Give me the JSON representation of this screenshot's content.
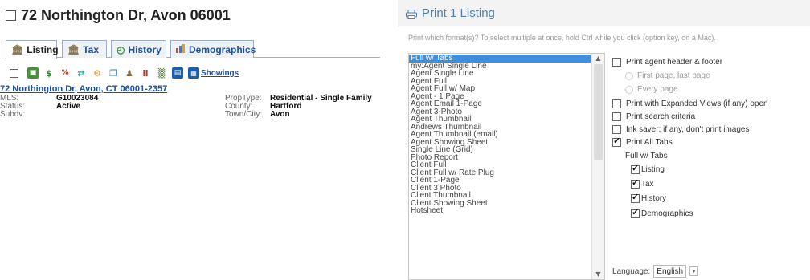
{
  "listing": {
    "title": "72 Northington Dr, Avon 06001",
    "tabs": [
      {
        "label": "Listing",
        "icon": "house-icon"
      },
      {
        "label": "Tax",
        "icon": "house-icon"
      },
      {
        "label": "History",
        "icon": "clock-icon"
      },
      {
        "label": "Demographics",
        "icon": "bar-chart-icon"
      }
    ],
    "showings_label": "Showings",
    "address_link": "72 Northington Dr, Avon, CT 06001-2357",
    "facts_left": [
      {
        "label": "MLS:",
        "value": "G10023084"
      },
      {
        "label": "Status:",
        "value": "Active"
      },
      {
        "label": "Subdv:",
        "value": ""
      }
    ],
    "facts_right": [
      {
        "label": "PropType:",
        "value": "Residential - Single Family"
      },
      {
        "label": "County:",
        "value": "Hartford"
      },
      {
        "label": "Town/City:",
        "value": "Avon"
      }
    ]
  },
  "print_dialog": {
    "title": "Print 1 Listing",
    "instructions": "Print which format(s)? To select multiple at once, hold Ctrl while you click (option key, on a Mac).",
    "formats": [
      "Full w/ Tabs",
      "my:Agent Single Line",
      "Agent Single Line",
      "Agent Full",
      "Agent Full w/ Map",
      "Agent - 1 Page",
      "Agent Email 1-Page",
      "Agent 3-Photo",
      "Agent Thumbnail",
      "Andrews Thumbnail",
      "Agent Thumbnail (email)",
      "Agent Showing Sheet",
      "Single Line (Grid)",
      "Photo Report",
      "Client Full",
      "Client Full w/ Rate Plug",
      "Client 1-Page",
      "Client 3 Photo",
      "Client Thumbnail",
      "Client Showing Sheet",
      "Hotsheet"
    ],
    "selected_format": "Full w/ Tabs",
    "options": {
      "agent_header": "Print agent header & footer",
      "first_last": "First page, last page",
      "every_page": "Every page",
      "expanded_views": "Print with Expanded Views (if any) open",
      "search_criteria": "Print search criteria",
      "ink_saver": "Ink saver; if any, don't print images",
      "all_tabs": "Print All Tabs",
      "tabs_group_label": "Full w/ Tabs",
      "tab_listing": "Listing",
      "tab_tax": "Tax",
      "tab_history": "History",
      "tab_demographics": "Demographics"
    },
    "language_label": "Language:",
    "language_value": "English"
  }
}
